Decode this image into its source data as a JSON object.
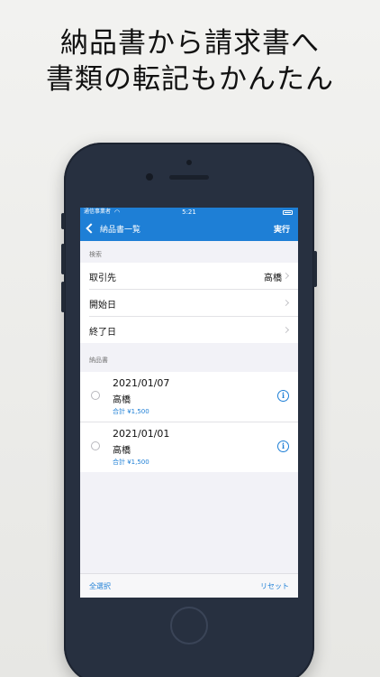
{
  "headline": {
    "line1": "納品書から請求書へ",
    "line2": "書類の転記もかんたん"
  },
  "status_bar": {
    "carrier": "通信事業者",
    "time": "5:21"
  },
  "nav": {
    "back_label": "納品書一覧",
    "action_label": "実行"
  },
  "search_section": {
    "header": "検索",
    "rows": [
      {
        "label": "取引先",
        "value": "高橋"
      },
      {
        "label": "開始日",
        "value": ""
      },
      {
        "label": "終了日",
        "value": ""
      }
    ]
  },
  "delivery_section": {
    "header": "納品書",
    "items": [
      {
        "date": "2021/01/07",
        "name": "高橋",
        "total": "合計 ¥1,500"
      },
      {
        "date": "2021/01/01",
        "name": "高橋",
        "total": "合計 ¥1,500"
      }
    ]
  },
  "toolbar": {
    "select_all": "全選択",
    "reset": "リセット"
  },
  "icons": {
    "back": "chevron-left-icon",
    "disclosure": "chevron-right-icon",
    "info": "info-icon",
    "radio": "radio-unchecked-icon",
    "wifi": "wifi-icon",
    "battery": "battery-icon"
  },
  "colors": {
    "accent": "#1e7fd6",
    "phone_body": "#273040",
    "screen_bg": "#f2f2f7"
  }
}
